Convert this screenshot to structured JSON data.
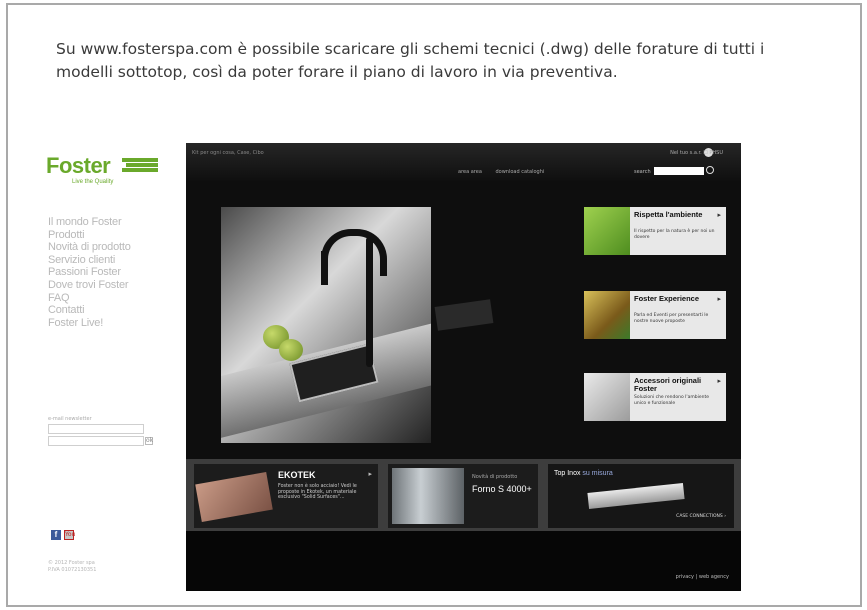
{
  "intro": {
    "line1": "Su www.fosterspa.com è possibile scaricare gli schemi tecnici (.dwg) delle forature di tutti i",
    "line2": "modelli sottotop, così da poter forare il piano di lavoro in via preventiva."
  },
  "site": {
    "logo": "Foster",
    "tagline": "Live the Quality",
    "nav": [
      "Il mondo Foster",
      "Prodotti",
      "Novità di prodotto",
      "Servizio clienti",
      "Passioni Foster",
      "Dove trovi Foster",
      "FAQ",
      "Contatti",
      "Foster Live!"
    ],
    "newsletter_label": "e-mail newsletter",
    "newsletter_btn": "ok",
    "facebook": "f",
    "youtube": "You",
    "copyright_line1": "© 2012 Foster spa",
    "copyright_line2": "P.IVA 01072130351",
    "breadcrumb": "Kit per ogni cosa, Case, Cibo",
    "top_right": "Nel tuo s.a.r. ☐ PHSU",
    "top_links": [
      "area area",
      "download cataloghi"
    ],
    "search_label": "search",
    "promos": [
      {
        "title": "Rispetta l'ambiente",
        "desc": "Il rispetto per la natura è per noi un dovere",
        "color": "#7cb83a"
      },
      {
        "title": "Foster Experience",
        "desc": "Parla ed Eventi per presentarti le nostre nuove proposte",
        "color": "#caa63a"
      },
      {
        "title": "Accessori originali Foster",
        "desc": "Soluzioni che rendono l'ambiente unico e funzionale",
        "color": "#bfbfbf"
      }
    ],
    "tiles": {
      "ekotek_title": "EKOTEK",
      "ekotek_desc": "Foster non è solo acciaio! Vedi le proposte in Ekotek, un materiale esclusivo \"Solid Surfaces\"...",
      "forno_small": "Novità di prodotto",
      "forno_title": "Forno S 4000+",
      "inox_title": "Top Inox",
      "inox_sub": "su misura",
      "inox_link": "CASE CONNECTIONS ›"
    },
    "footer_links": "privacy  |  web agency"
  }
}
